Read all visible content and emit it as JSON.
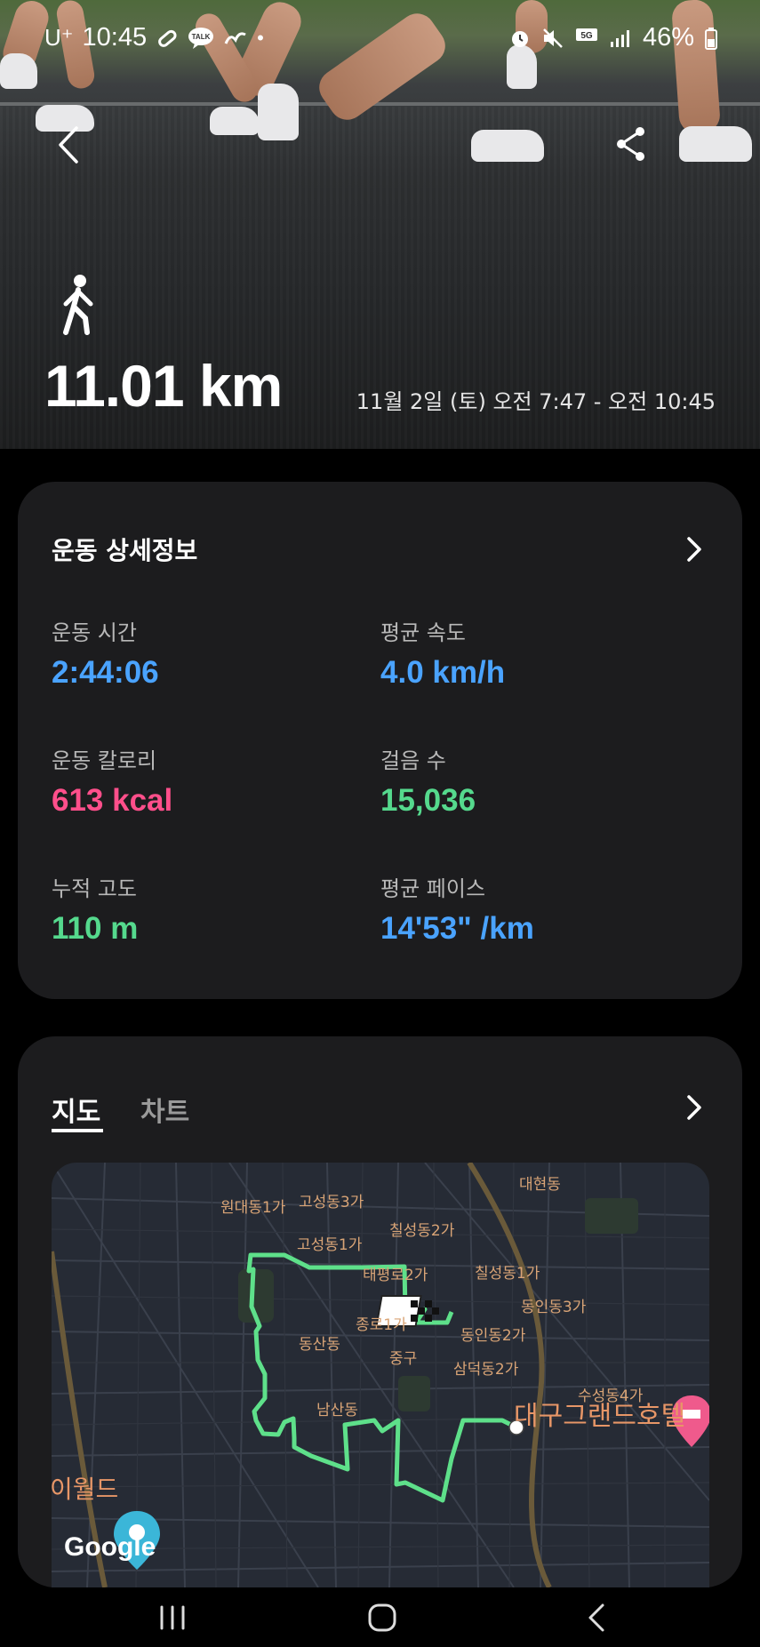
{
  "status": {
    "carrier": "U⁺",
    "time": "10:45",
    "battery": "46%",
    "icons_left": [
      "pill-icon",
      "talk-icon",
      "hand-icon",
      "dot-icon"
    ],
    "icons_right": [
      "alarm-icon",
      "mute-icon",
      "5g-icon",
      "signal-icon",
      "battery-icon"
    ]
  },
  "header": {
    "activity_icon": "walking-icon",
    "distance": "11.01 km",
    "datetime": "11월 2일 (토) 오전 7:47 - 오전 10:45"
  },
  "details": {
    "title": "운동 상세정보",
    "stats": [
      {
        "label": "운동 시간",
        "value": "2:44:06",
        "color": "#4aa3ff"
      },
      {
        "label": "평균 속도",
        "value": "4.0 km/h",
        "color": "#4aa3ff"
      },
      {
        "label": "운동 칼로리",
        "value": "613 kcal",
        "color": "#ff4f8b"
      },
      {
        "label": "걸음 수",
        "value": "15,036",
        "color": "#55d98d"
      },
      {
        "label": "누적 고도",
        "value": "110 m",
        "color": "#55d98d"
      },
      {
        "label": "평균 페이스",
        "value": "14'53\" /km",
        "color": "#4aa3ff"
      }
    ]
  },
  "map_section": {
    "tabs": [
      {
        "label": "지도",
        "active": true
      },
      {
        "label": "차트",
        "active": false
      }
    ],
    "attribution": "Google",
    "labels": [
      "대현동",
      "원대동1가",
      "고성동3가",
      "칠성동2가",
      "고성동1가",
      "태평로2가",
      "칠성동1가",
      "동인동3가",
      "종로1가",
      "동인동2가",
      "동산동",
      "중구",
      "삼덕동2가",
      "수성동4가",
      "남산동",
      "대구그랜드호텔",
      "이월드"
    ],
    "route_color": "#5ee08a"
  }
}
